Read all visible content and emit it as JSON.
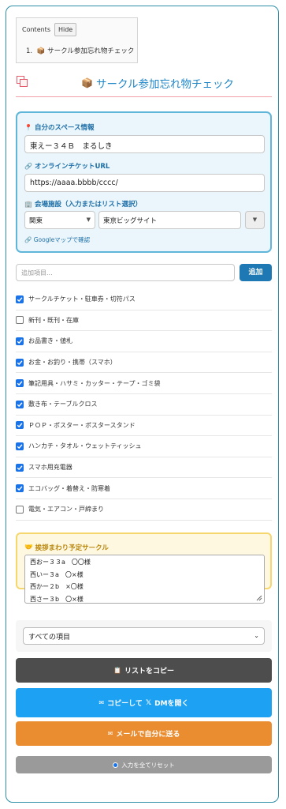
{
  "toc": {
    "heading": "Contents",
    "hide_label": "Hide",
    "items": [
      {
        "num": "1.",
        "icon": "📦",
        "label": "サークル参加忘れ物チェック"
      }
    ]
  },
  "title": {
    "icon": "📦",
    "text": "サークル参加忘れ物チェック"
  },
  "info": {
    "space_label": "自分のスペース情報",
    "space_value": "東えー３４Ｂ　まるしき",
    "ticket_label": "オンラインチケットURL",
    "ticket_value": "https://aaaa.bbbb/cccc/",
    "venue_label": "会場施設（入力またはリスト選択）",
    "region_value": "関東",
    "venue_value": "東京ビッグサイト",
    "map_link": "Googleマップで確認"
  },
  "add": {
    "placeholder": "追加項目...",
    "button_label": "追加"
  },
  "checklist": [
    {
      "label": "サークルチケット・駐車券・切符パス",
      "checked": true
    },
    {
      "label": "新刊・既刊・在庫",
      "checked": false
    },
    {
      "label": "お品書き・値札",
      "checked": true
    },
    {
      "label": "お金・お釣り・携帯（スマホ）",
      "checked": true
    },
    {
      "label": "筆記用具・ハサミ・カッター・テープ・ゴミ袋",
      "checked": true
    },
    {
      "label": "敷き布・テーブルクロス",
      "checked": true
    },
    {
      "label": "ＰＯＰ・ポスター・ポスタースタンド",
      "checked": true
    },
    {
      "label": "ハンカチ・タオル・ウェットティッシュ",
      "checked": true
    },
    {
      "label": "スマホ用充電器",
      "checked": true
    },
    {
      "label": "エコバッグ・着替え・防寒着",
      "checked": true
    },
    {
      "label": "電気・エアコン・戸締まり",
      "checked": false
    }
  ],
  "greeting": {
    "label": "挨拶まわり予定サークル",
    "lines": [
      "西おー３３a　〇〇様",
      "西いー３a　〇×様",
      "西かー２b　×〇様",
      "西さー３b　〇×様"
    ]
  },
  "filter": {
    "value": "すべての項目"
  },
  "buttons": {
    "copy": "リストをコピー",
    "dm_prefix": "コピーして",
    "dm_suffix": "DMを開く",
    "mail": "メールで自分に送る",
    "reset": "入力を全てリセット"
  },
  "colors": {
    "accent": "#1e78b4",
    "panel_border": "#5fb6d8",
    "checkbox": "#1a73e8",
    "dm": "#1da1f2",
    "mail": "#ea8c30",
    "copy": "#4d4d4d"
  }
}
